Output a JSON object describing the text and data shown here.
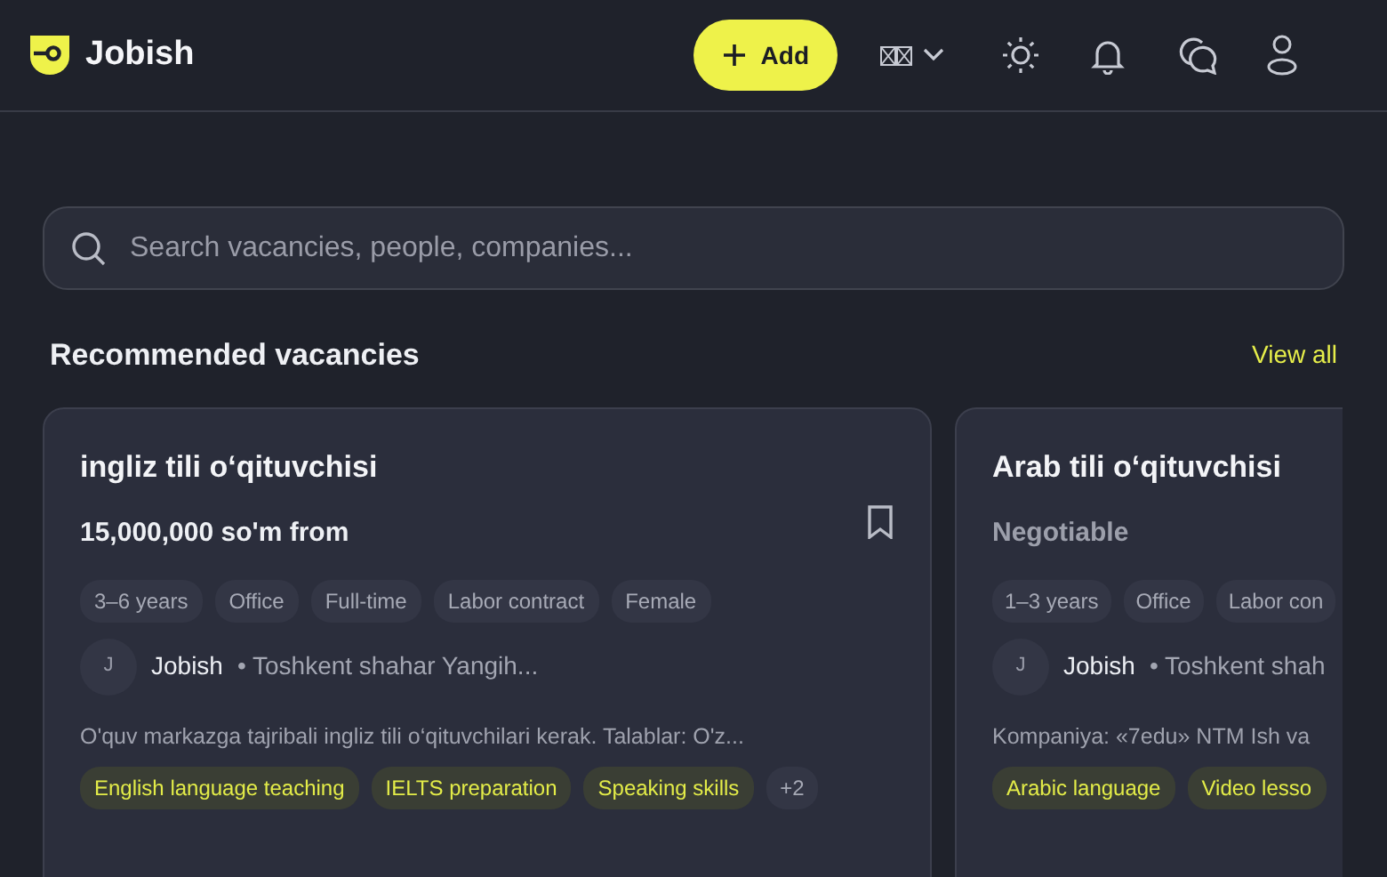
{
  "header": {
    "logo_text": "Jobish",
    "add_button": "Add"
  },
  "search": {
    "placeholder": "Search vacancies, people, companies..."
  },
  "section": {
    "title": "Recommended vacancies",
    "view_all": "View all"
  },
  "vacancies": [
    {
      "title": "ingliz tili o‘qituvchisi",
      "salary": "15,000,000 so'm from",
      "salary_muted": false,
      "bookmarked": false,
      "clipped": false,
      "tags": [
        "3–6 years",
        "Office",
        "Full-time",
        "Labor contract",
        "Female"
      ],
      "avatar": "J",
      "company": "Jobish",
      "location": "• Toshkent shahar Yangih...",
      "description": "O'quv markazga tajribali ingliz tili o‘qituvchilari kerak. Talablar: O'z...",
      "skills": [
        "English language teaching",
        "IELTS preparation",
        "Speaking skills"
      ],
      "more": "+2"
    },
    {
      "title": "Arab tili o‘qituvchisi",
      "salary": "Negotiable",
      "salary_muted": true,
      "clipped": true,
      "tags": [
        "1–3 years",
        "Office",
        "Labor con"
      ],
      "avatar": "J",
      "company": "Jobish",
      "location": "• Toshkent shah",
      "description": "Kompaniya: «7edu» NTM Ish va",
      "skills": [
        "Arabic language",
        "Video lesso"
      ]
    }
  ]
}
